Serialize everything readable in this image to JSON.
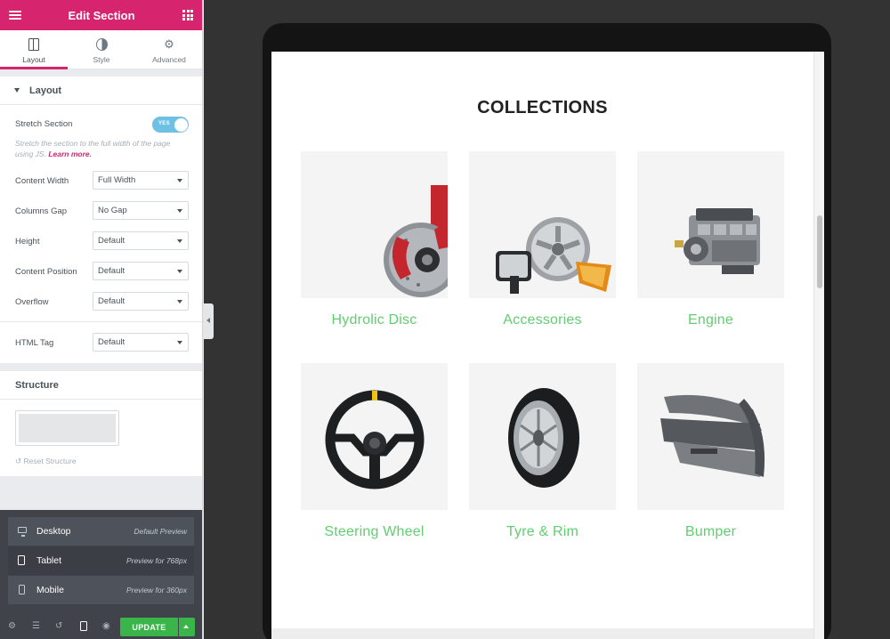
{
  "panel": {
    "title": "Edit Section",
    "tabs": [
      {
        "label": "Layout",
        "icon": "columns-icon",
        "active": true
      },
      {
        "label": "Style",
        "icon": "half-circle-icon",
        "active": false
      },
      {
        "label": "Advanced",
        "icon": "gear-icon",
        "active": false
      }
    ],
    "layout": {
      "heading": "Layout",
      "stretch": {
        "label": "Stretch Section",
        "switch_text": "YES",
        "on": true
      },
      "description": "Stretch the section to the full width of the page using JS.",
      "learn_more": "Learn more.",
      "controls": [
        {
          "label": "Content Width",
          "value": "Full Width"
        },
        {
          "label": "Columns Gap",
          "value": "No Gap"
        },
        {
          "label": "Height",
          "value": "Default"
        },
        {
          "label": "Content Position",
          "value": "Default"
        },
        {
          "label": "Overflow",
          "value": "Default"
        }
      ],
      "html_tag": {
        "label": "HTML Tag",
        "value": "Default"
      }
    },
    "structure": {
      "heading": "Structure",
      "reset": "Reset Structure"
    },
    "responsive": [
      {
        "name": "Desktop",
        "hint": "Default Preview",
        "icon": "desktop-icon"
      },
      {
        "name": "Tablet",
        "hint": "Preview for 768px",
        "icon": "tablet-icon",
        "active": true
      },
      {
        "name": "Mobile",
        "hint": "Preview for 360px",
        "icon": "mobile-icon"
      }
    ],
    "footer": {
      "update_label": "UPDATE"
    }
  },
  "preview": {
    "heading": "COLLECTIONS",
    "caption_color": "#61ce70",
    "items": [
      {
        "caption": "Hydrolic Disc"
      },
      {
        "caption": "Accessories"
      },
      {
        "caption": "Engine"
      },
      {
        "caption": "Steering Wheel"
      },
      {
        "caption": "Tyre & Rim"
      },
      {
        "caption": "Bumper"
      }
    ]
  },
  "colors": {
    "brand": "#d6246f",
    "update": "#39b54a",
    "switch": "#6ec1e4"
  }
}
